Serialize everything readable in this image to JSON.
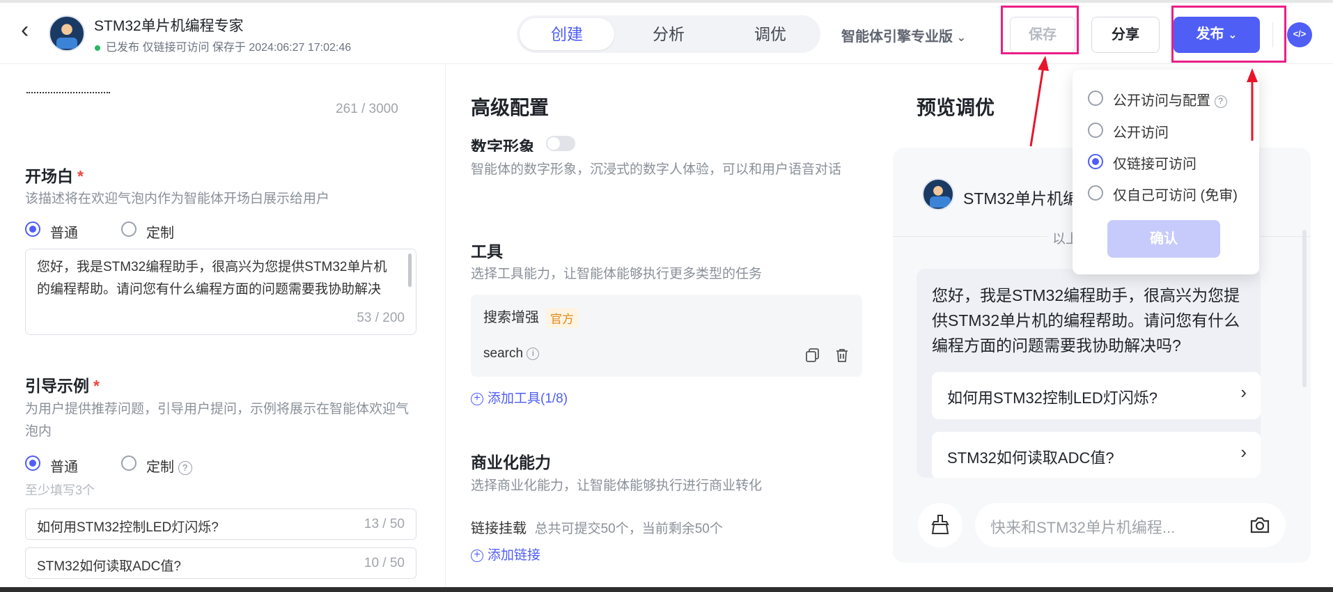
{
  "header": {
    "app_name": "STM32单片机编程专家",
    "status": "已发布 仅链接可访问 保存于 2024:06:27 17:02:46",
    "tabs": [
      {
        "label": "创建"
      },
      {
        "label": "分析"
      },
      {
        "label": "调优"
      }
    ],
    "engine": "智能体引擎专业版",
    "save_label": "保存",
    "share_label": "分享",
    "publish_label": "发布",
    "code_icon": "</>"
  },
  "left": {
    "intro_counter": "261 / 3000",
    "opening": {
      "title": "开场白",
      "required": "*",
      "desc": "该描述将在欢迎气泡内作为智能体开场白展示给用户",
      "opt_normal": "普通",
      "opt_custom": "定制",
      "text": "您好，我是STM32编程助手，很高兴为您提供STM32单片机的编程帮助。请问您有什么编程方面的问题需要我协助解决吗?",
      "count": "53 / 200"
    },
    "guide": {
      "title": "引导示例",
      "required": "*",
      "desc": "为用户提供推荐问题，引导用户提问，示例将展示在智能体欢迎气泡内",
      "opt_normal": "普通",
      "opt_custom": "定制",
      "hint": "至少填写3个",
      "examples": [
        {
          "text": "如何用STM32控制LED灯闪烁?",
          "count": "13 / 50"
        },
        {
          "text": "STM32如何读取ADC值?",
          "count": "10 / 50"
        }
      ]
    }
  },
  "middle": {
    "title": "高级配置",
    "digital_title": "数字形象",
    "digital_desc": "智能体的数字形象，沉浸式的数字人体验，可以和用户语音对话",
    "tools_title": "工具",
    "tools_desc": "选择工具能力，让智能体能够执行更多类型的任务",
    "tool_name": "搜索增强",
    "tool_badge": "官方",
    "tool_id": "search",
    "add_tool": "添加工具(1/8)",
    "biz_title": "商业化能力",
    "biz_desc": "选择商业化能力，让智能体能够执行进行商业转化",
    "link_title": "链接挂载",
    "link_note": "总共可提交50个，当前剩余50个",
    "add_link": "添加链接"
  },
  "right": {
    "title": "预览调优",
    "bot_name": "STM32单片机编",
    "divider_text": "以上",
    "welcome": "您好，我是STM32编程助手，很高兴为您提供STM32单片机的编程帮助。请问您有什么编程方面的问题需要我协助解决吗?",
    "questions": [
      {
        "text": "如何用STM32控制LED灯闪烁?"
      },
      {
        "text": "STM32如何读取ADC值?"
      }
    ],
    "input_placeholder": "快来和STM32单片机编程..."
  },
  "dropdown": {
    "options": [
      {
        "label": "公开访问与配置"
      },
      {
        "label": "公开访问"
      },
      {
        "label": "仅链接可访问"
      },
      {
        "label": "仅自己可访问 (免审)"
      }
    ],
    "selected_index": 2,
    "confirm_label": "确认"
  },
  "colors": {
    "accent": "#4f5ef5",
    "annotation": "#ea1e86",
    "required": "#f0463c"
  }
}
